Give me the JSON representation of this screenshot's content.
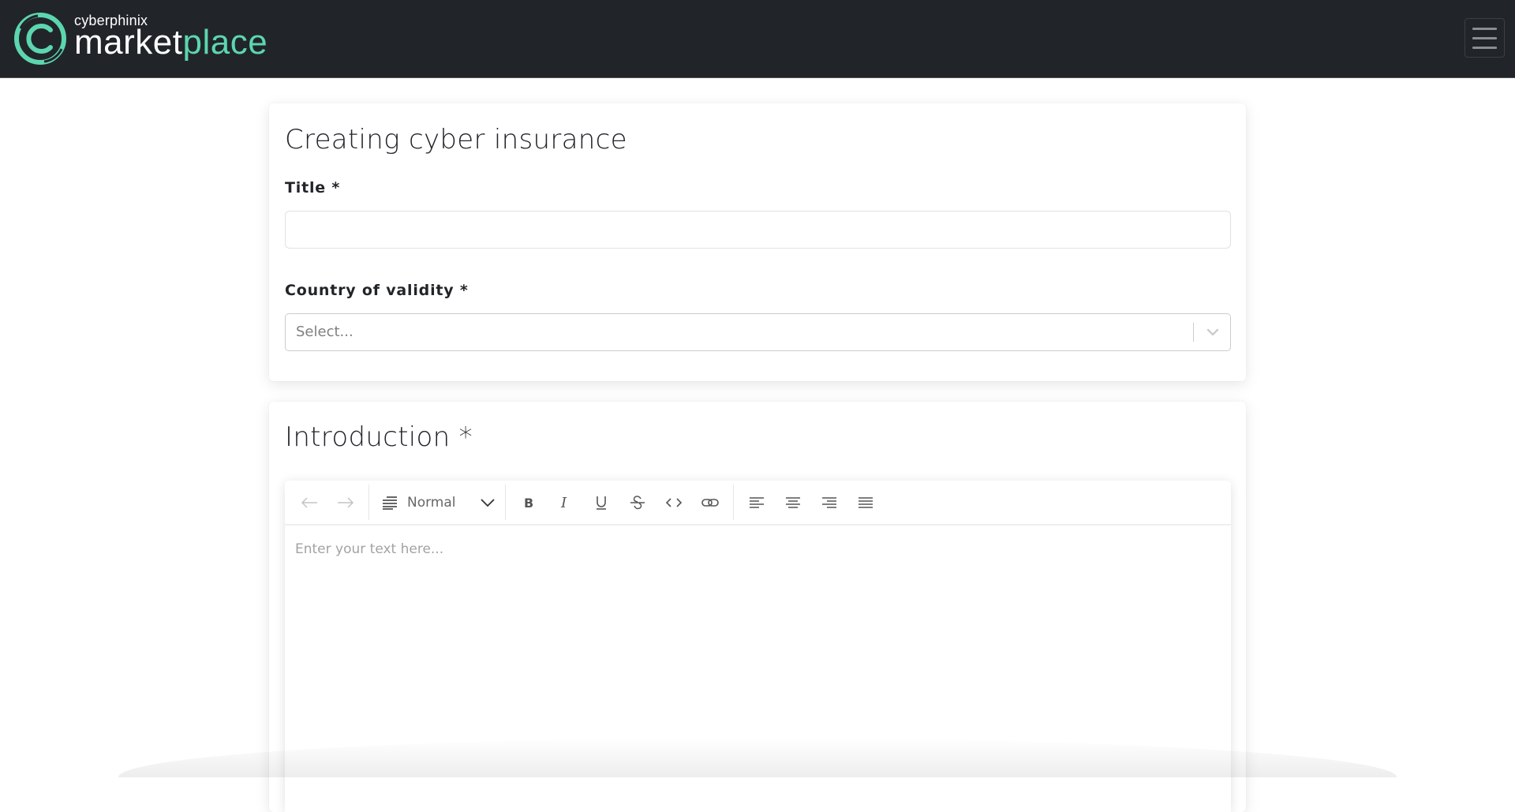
{
  "navbar": {
    "brand_small": "cyberphinix",
    "brand_big_white": "market",
    "brand_big_green": "place",
    "brand_color": "#5cd6ae",
    "menu_icon": "hamburger-menu-icon"
  },
  "form_card": {
    "title": "Creating cyber insurance",
    "fields": {
      "title": {
        "label": "Title *",
        "value": "",
        "placeholder": ""
      },
      "country": {
        "label": "Country of validity *",
        "placeholder": "Select...",
        "value": ""
      }
    }
  },
  "introduction_card": {
    "title": "Introduction *",
    "editor": {
      "toolbar": {
        "history": [
          {
            "name": "undo",
            "icon": "arrow-left-icon",
            "enabled": false
          },
          {
            "name": "redo",
            "icon": "arrow-right-icon",
            "enabled": false
          }
        ],
        "block_type": {
          "icon": "text-lines-icon",
          "selected": "Normal"
        },
        "inline": [
          {
            "name": "bold",
            "icon": "bold-icon"
          },
          {
            "name": "italic",
            "icon": "italic-icon"
          },
          {
            "name": "underline",
            "icon": "underline-icon"
          },
          {
            "name": "strikethrough",
            "icon": "strikethrough-icon"
          },
          {
            "name": "code",
            "icon": "code-icon"
          },
          {
            "name": "link",
            "icon": "link-icon"
          }
        ],
        "alignment": [
          {
            "name": "align-left",
            "icon": "align-left-icon"
          },
          {
            "name": "align-center",
            "icon": "align-center-icon"
          },
          {
            "name": "align-right",
            "icon": "align-right-icon"
          },
          {
            "name": "align-justify",
            "icon": "align-justify-icon"
          }
        ]
      },
      "placeholder": "Enter your text here...",
      "value": ""
    }
  }
}
